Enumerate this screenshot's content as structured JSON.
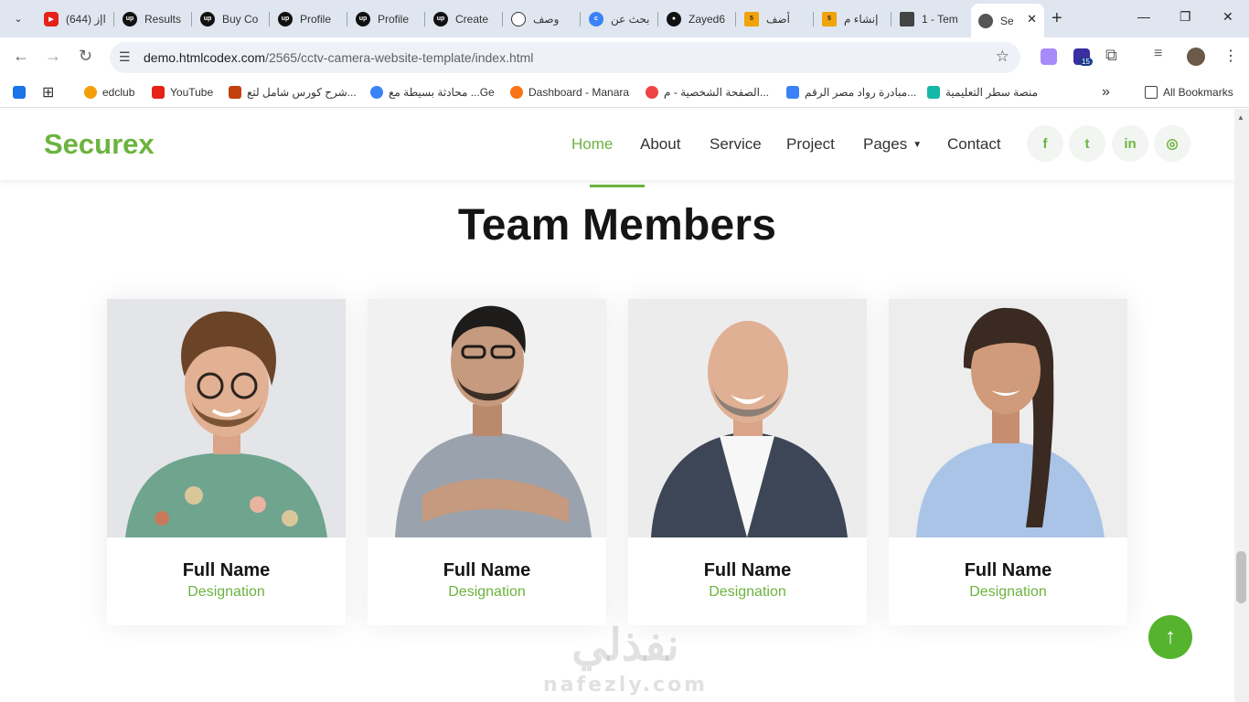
{
  "browser": {
    "tabs": [
      {
        "title": "(644) اإز",
        "icon": "youtube-icon"
      },
      {
        "title": "Results",
        "icon": "upwork-icon"
      },
      {
        "title": "Buy Co",
        "icon": "upwork-icon"
      },
      {
        "title": "Profile",
        "icon": "upwork-icon"
      },
      {
        "title": "Profile",
        "icon": "upwork-icon"
      },
      {
        "title": "Create",
        "icon": "upwork-icon"
      },
      {
        "title": "وصف",
        "icon": "openai-icon"
      },
      {
        "title": "بحث عن",
        "icon": "copilot-icon"
      },
      {
        "title": "Zayed6",
        "icon": "github-icon"
      },
      {
        "title": "أضف",
        "icon": "mostaql-icon"
      },
      {
        "title": "إنشاء م",
        "icon": "mostaql-icon"
      },
      {
        "title": "1 - Tem",
        "icon": "document-icon"
      },
      {
        "title": "Se",
        "icon": "globe-icon"
      }
    ],
    "active_tab_close": "✕",
    "new_tab": "+",
    "window_controls": {
      "minimize": "—",
      "restore": "❐",
      "close": "✕"
    },
    "address": {
      "host": "demo.htmlcodex.com",
      "path": "/2565/cctv-camera-website-template/index.html"
    },
    "extension_badge": "15",
    "bookmarks": [
      {
        "label": "edclub",
        "color": "#f59e0b"
      },
      {
        "label": "YouTube",
        "color": "#e62117"
      },
      {
        "label": "شرح كورس شامل لتع...",
        "color": "#c2410c"
      },
      {
        "label": "محادثة بسيطة مع ...Ge",
        "color": "#3b82f6"
      },
      {
        "label": "Dashboard - Manara",
        "color": "#f97316"
      },
      {
        "label": "الصفحة الشخصية - م...",
        "color": "#ef4444"
      },
      {
        "label": "مبادرة رواد مصر الرقم...",
        "color": "#3b82f6"
      },
      {
        "label": "منصة سطر التعليمية",
        "color": "#14b8a6"
      }
    ],
    "bookmarks_overflow": "»",
    "all_bookmarks": "All Bookmarks"
  },
  "site": {
    "brand": "Securex",
    "brand_color": "#6cb33f",
    "nav": [
      "Home",
      "About",
      "Service",
      "Project",
      "Pages",
      "Contact"
    ],
    "active_nav": "Home",
    "social": [
      {
        "icon": "facebook-icon",
        "glyph": "f"
      },
      {
        "icon": "twitter-icon",
        "glyph": "t"
      },
      {
        "icon": "linkedin-icon",
        "glyph": "in"
      },
      {
        "icon": "instagram-icon",
        "glyph": "◎"
      }
    ]
  },
  "section": {
    "title": "Team Members",
    "members": [
      {
        "name": "Full Name",
        "designation": "Designation"
      },
      {
        "name": "Full Name",
        "designation": "Designation"
      },
      {
        "name": "Full Name",
        "designation": "Designation"
      },
      {
        "name": "Full Name",
        "designation": "Designation"
      }
    ]
  },
  "back_to_top": "↑",
  "watermark": {
    "arabic": "نفذلي",
    "latin": "nafezly.com"
  }
}
